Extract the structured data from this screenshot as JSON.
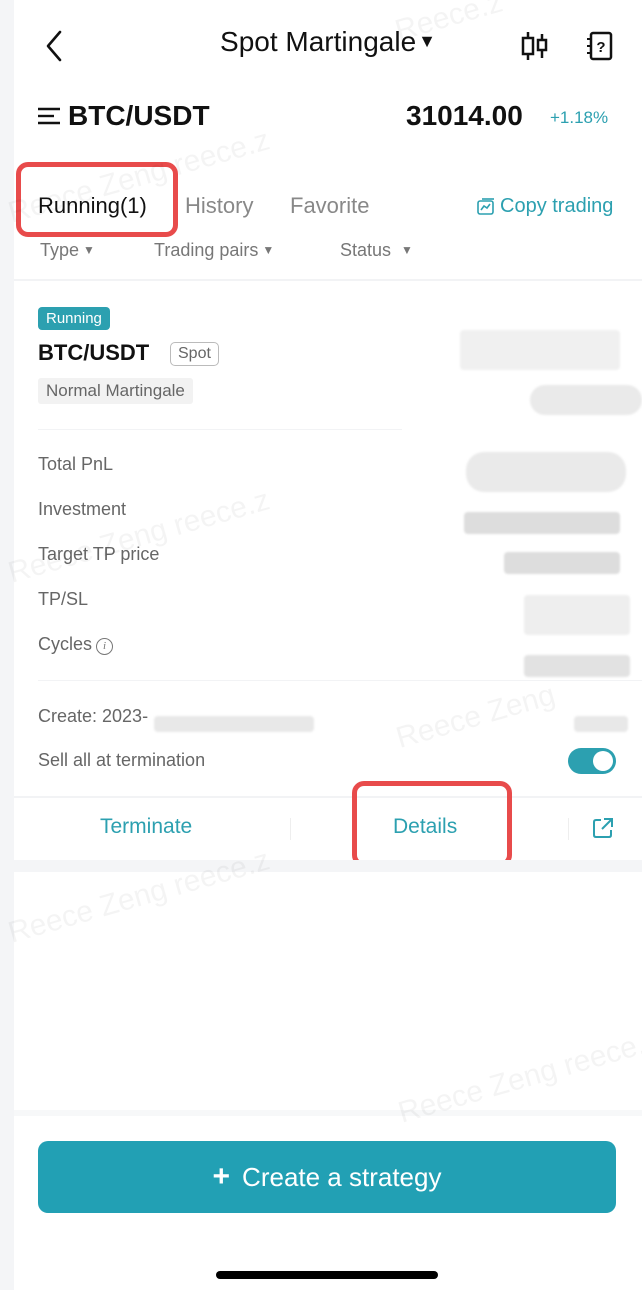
{
  "header": {
    "title": "Spot Martingale",
    "title_caret": "▼",
    "icons": [
      "back-chevron-icon",
      "candlestick-chart-icon",
      "help-notebook-icon"
    ]
  },
  "ticker": {
    "pair": "BTC/USDT",
    "price": "31014.00",
    "change": "+1.18%"
  },
  "tabs": [
    {
      "label": "Running(1)",
      "active": true
    },
    {
      "label": "History",
      "active": false
    },
    {
      "label": "Favorite",
      "active": false
    }
  ],
  "copy_trading": "Copy trading",
  "filters": [
    {
      "label": "Type"
    },
    {
      "label": "Trading pairs"
    },
    {
      "label": "Status"
    }
  ],
  "filter_caret": "▼",
  "card": {
    "status_badge": "Running",
    "pair": "BTC/USDT",
    "market": "Spot",
    "mode": "Normal Martingale",
    "fields": [
      {
        "label": "Total PnL"
      },
      {
        "label": "Investment"
      },
      {
        "label": "Target TP price"
      },
      {
        "label": "TP/SL"
      },
      {
        "label": "Cycles"
      }
    ],
    "cycles_info_icon": "i",
    "create_label": "Create: 2023-",
    "sell_all_label": "Sell all at termination",
    "sell_all_enabled": true,
    "actions": {
      "terminate": "Terminate",
      "details": "Details"
    }
  },
  "create_button": {
    "plus": "+",
    "label": "Create a strategy"
  },
  "colors": {
    "accent": "#2ca0b0",
    "highlight": "#e84b4b"
  },
  "watermarks": [
    "Reece.z",
    "Reece Zeng reece.z",
    "Reece Zeng",
    "Reece Zeng reece.z",
    "Reece Zeng reece.z",
    "Reece Zeng reece.z"
  ]
}
